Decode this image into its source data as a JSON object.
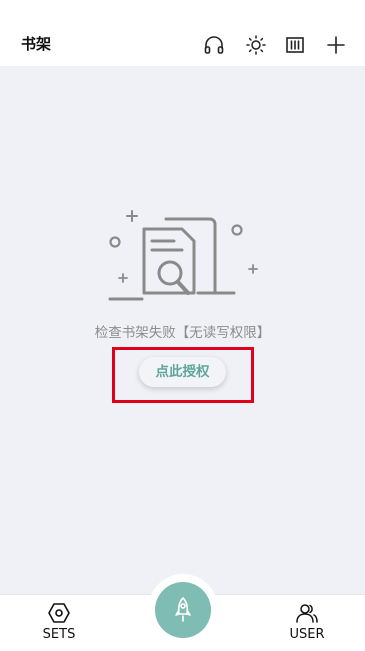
{
  "header": {
    "title": "书架",
    "icons": [
      "headphones-icon",
      "brightness-icon",
      "bookshelf-layout-icon",
      "add-icon"
    ]
  },
  "empty_state": {
    "message": "检查书架失败【无读写权限】",
    "button_label": "点此授权",
    "illustration": "document-search-icon"
  },
  "bottom_nav": {
    "left": {
      "label": "SETS",
      "icon": "hexagon-settings-icon"
    },
    "center": {
      "icon": "rocket-icon"
    },
    "right": {
      "label": "USER",
      "icon": "users-icon"
    }
  },
  "colors": {
    "accent": "#7fbcb3",
    "button_text": "#5fa59c",
    "highlight": "#e0001b",
    "background": "#f0f1f6"
  }
}
